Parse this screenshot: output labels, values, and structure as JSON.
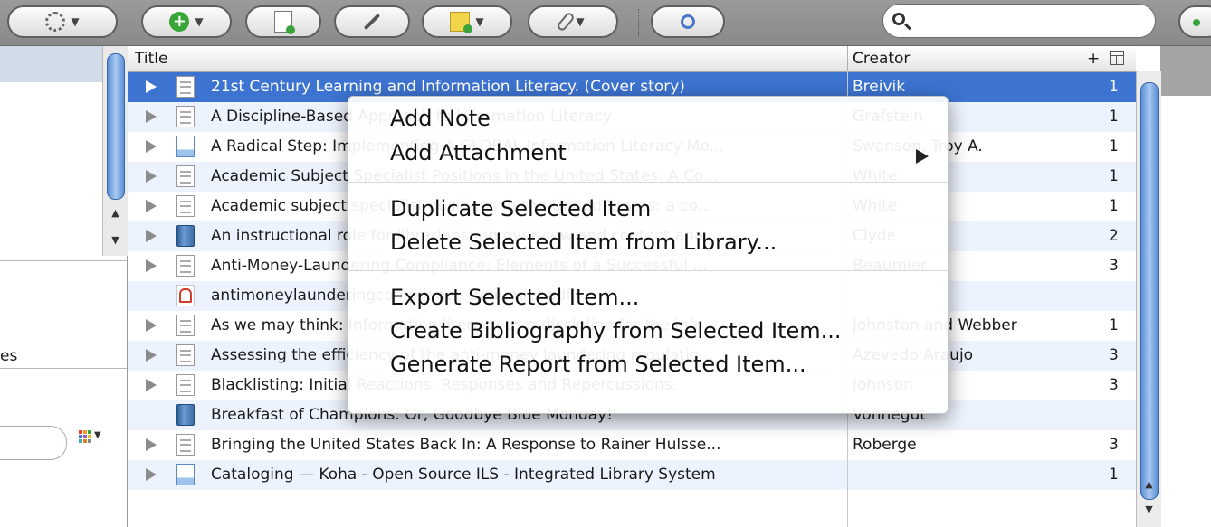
{
  "toolbar": {
    "search": {
      "value": "",
      "placeholder": ""
    }
  },
  "left_pane": {
    "partial_label": "es"
  },
  "tag_colors": [
    "#e63c3c",
    "#f0a020",
    "#3aa23a",
    "#3c78d8",
    "#9b59b6",
    "#e6c020",
    "#3ab0b0",
    "#e67e22",
    "#7f8c8d"
  ],
  "table": {
    "columns": {
      "title": "Title",
      "creator": "Creator",
      "plus": "+"
    },
    "rows": [
      {
        "title": "21st Century Learning and Information Literacy. (Cover story)",
        "creator": "Breivik",
        "count": "1",
        "icon": "article",
        "expander": true,
        "selected": true
      },
      {
        "title": "A Discipline-Based Approach to Information Literacy",
        "creator": "Grafstein",
        "count": "1",
        "icon": "article",
        "expander": true
      },
      {
        "title": "A Radical Step: Implementing A GLOBAL Information Literacy Mo...",
        "creator": "Swanson, Troy A.",
        "count": "1",
        "icon": "webpage",
        "expander": true
      },
      {
        "title": "Academic Subject Specialist Positions in the United States: A Co...",
        "creator": "White",
        "count": "1",
        "icon": "article",
        "expander": true
      },
      {
        "title": "Academic subject specialist positions in the United States: a co...",
        "creator": "White",
        "count": "1",
        "icon": "article",
        "expander": true
      },
      {
        "title": "An instructional role for librarians: an overview and content ana...",
        "creator": "Clyde",
        "count": "2",
        "icon": "book",
        "expander": true
      },
      {
        "title": "Anti-Money-Laundering Compliance: Elements of a Successful ...",
        "creator": "Beaumier",
        "count": "3",
        "icon": "article",
        "expander": true
      },
      {
        "title": "antimoneylaunderingcompliance Beaumier.pdf",
        "creator": "",
        "count": "",
        "icon": "pdf",
        "expander": false
      },
      {
        "title": "As we may think: Information literacy as a discipline for the info...",
        "creator": "Johnston and Webber",
        "count": "1",
        "icon": "article",
        "expander": true
      },
      {
        "title": "Assessing the efficiency of the anti-money laundering regulatio...",
        "creator": "Azevedo Araujo",
        "count": "3",
        "icon": "article",
        "expander": true
      },
      {
        "title": "Blacklisting: Initial Reactions, Responses and Repercussions.",
        "creator": "Johnson",
        "count": "3",
        "icon": "article",
        "expander": true
      },
      {
        "title": "Breakfast of Champions: Or, Goodbye Blue Monday!",
        "creator": "Vonnegut",
        "count": "",
        "icon": "book",
        "expander": false
      },
      {
        "title": "Bringing the United States Back In: A Response to Rainer Hulsse...",
        "creator": "Roberge",
        "count": "3",
        "icon": "article",
        "expander": true
      },
      {
        "title": "Cataloging — Koha - Open Source ILS - Integrated Library System",
        "creator": "",
        "count": "1",
        "icon": "webpage",
        "expander": true
      }
    ]
  },
  "context_menu": {
    "items": [
      {
        "label": "Add Note"
      },
      {
        "label": "Add Attachment",
        "submenu": true
      },
      {
        "label": "Duplicate Selected Item"
      },
      {
        "label": "Delete Selected Item from Library..."
      },
      {
        "label": "Export Selected Item..."
      },
      {
        "label": "Create Bibliography from Selected Item..."
      },
      {
        "label": "Generate Report from Selected Item..."
      }
    ]
  },
  "icons": {
    "actions": "gear-icon",
    "new_item": "plus-circle-icon",
    "new_from_file": "document-add-icon",
    "add_by_identifier": "magic-wand-icon",
    "new_note": "note-add-icon",
    "attachment": "paperclip-icon",
    "advanced_search": "magnifier-icon"
  }
}
